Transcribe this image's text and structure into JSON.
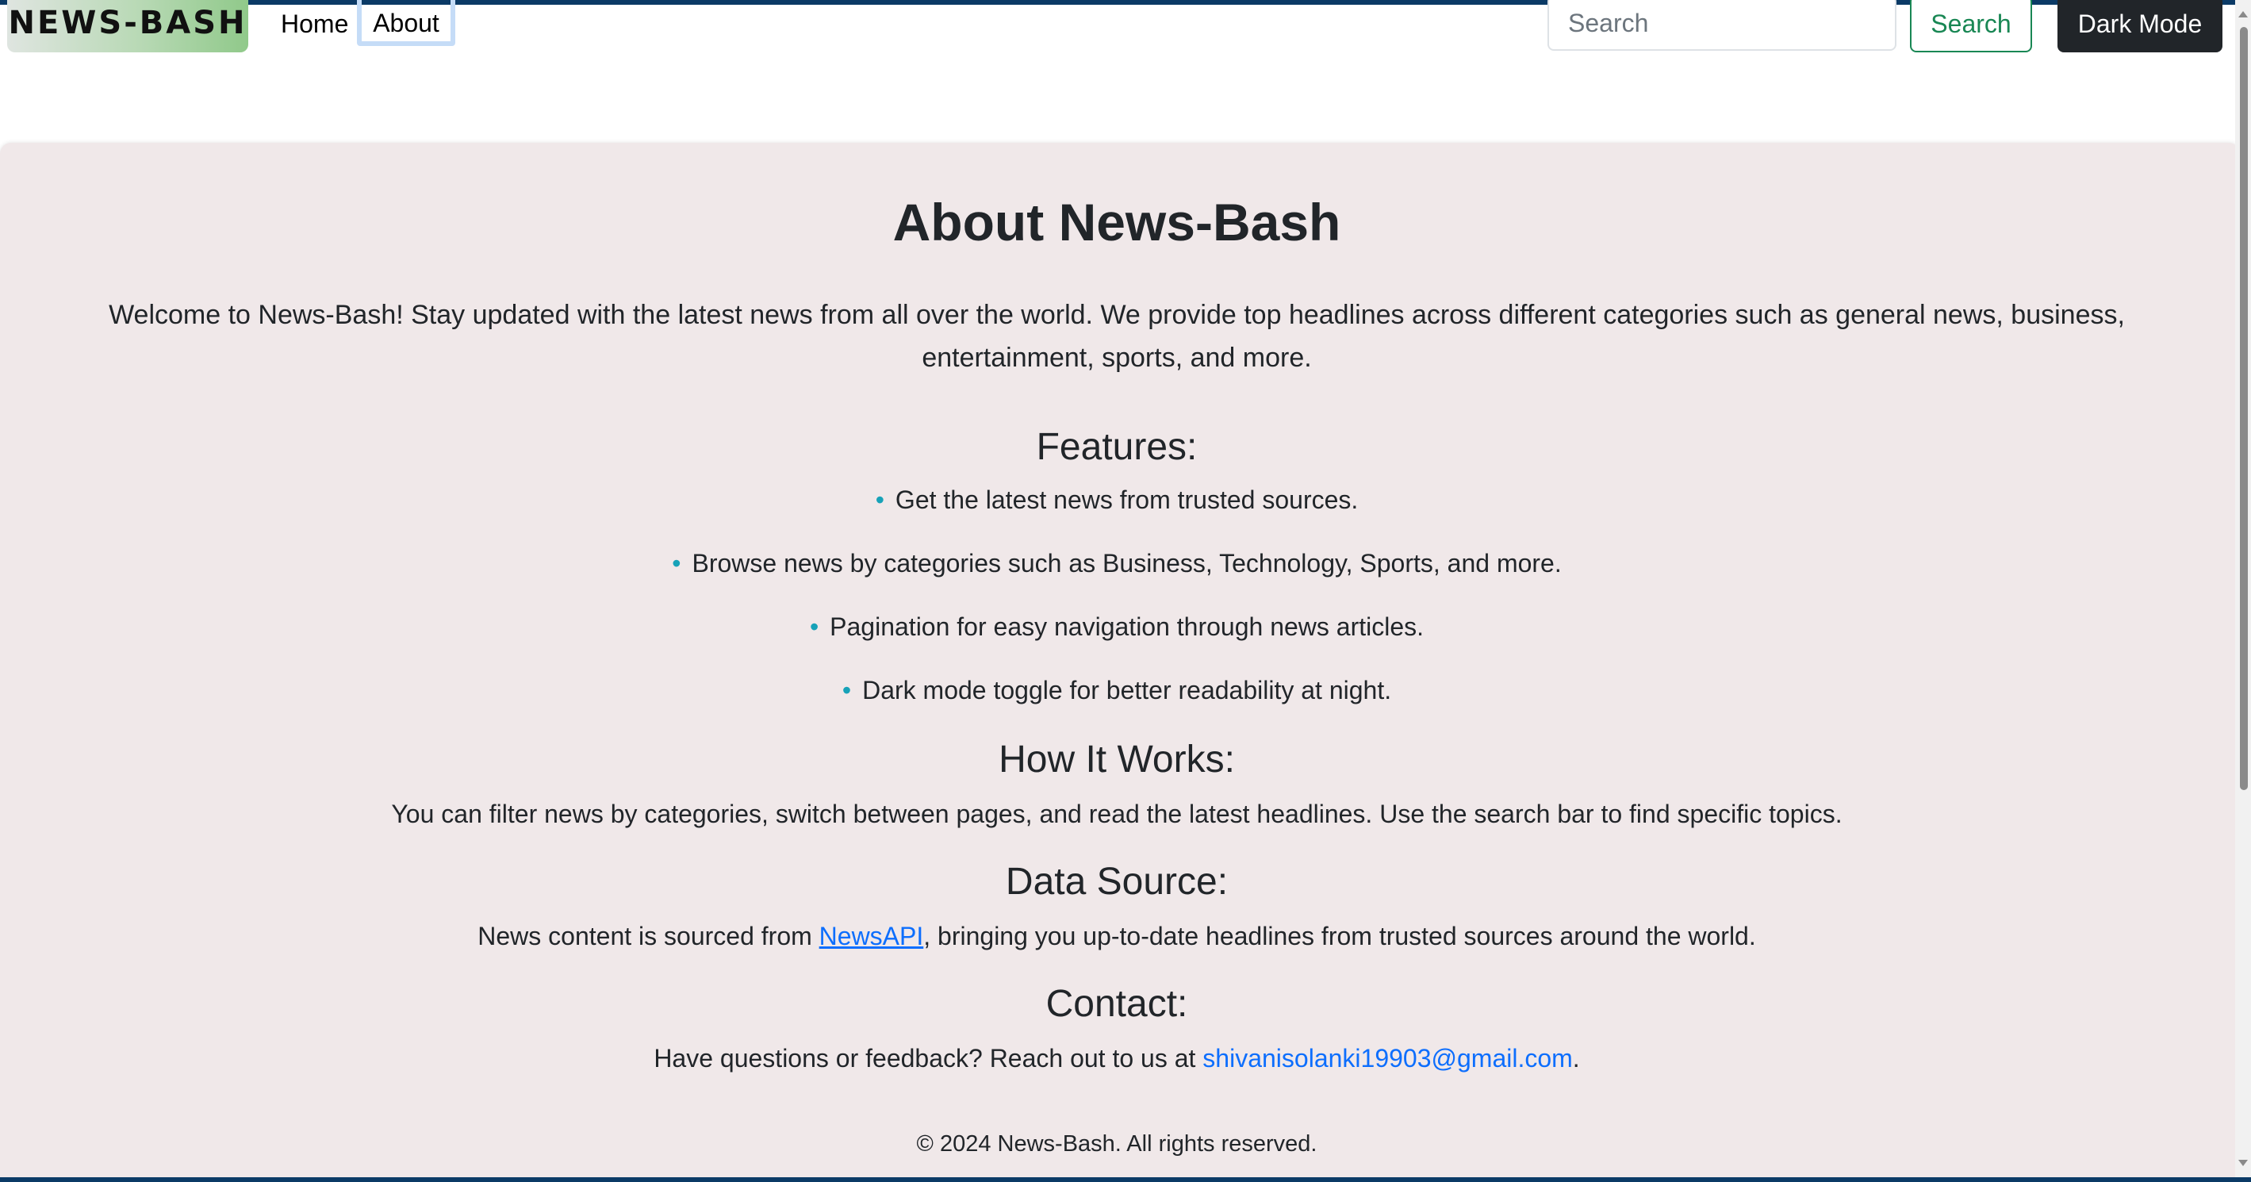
{
  "navbar": {
    "brand": "NEWS-BASH",
    "links": [
      {
        "label": "Home"
      },
      {
        "label": "About"
      }
    ],
    "search": {
      "placeholder": "Search",
      "value": ""
    },
    "search_button": "Search",
    "dark_mode_button": "Dark Mode"
  },
  "about": {
    "title": "About News-Bash",
    "welcome": "Welcome to News-Bash! Stay updated with the latest news from all over the world. We provide top headlines across different categories such as general news, business, entertainment, sports, and more.",
    "features_heading": "Features:",
    "features": [
      "Get the latest news from trusted sources.",
      "Browse news by categories such as Business, Technology, Sports, and more.",
      "Pagination for easy navigation through news articles.",
      "Dark mode toggle for better readability at night."
    ],
    "bullet": "•",
    "how_heading": "How It Works:",
    "how_text": "You can filter news by categories, switch between pages, and read the latest headlines. Use the search bar to find specific topics.",
    "data_heading": "Data Source:",
    "data_text_before": "News content is sourced from ",
    "data_link": "NewsAPI",
    "data_text_after": ", bringing you up-to-date headlines from trusted sources around the world.",
    "contact_heading": "Contact:",
    "contact_text_before": "Have questions or feedback? Reach out to us at ",
    "contact_email": "shivanisolanki19903@gmail.com",
    "contact_text_after": "."
  },
  "footer": {
    "text": "© 2024 News-Bash. All rights reserved."
  },
  "colors": {
    "main_background": "#f0e8e9",
    "brand_gradient_end": "#90c98a",
    "search_button": "#198754",
    "dark_button": "#212529",
    "bullet": "#17a2b8",
    "link": "#0d6efd",
    "frame_border": "#0b3a66"
  }
}
